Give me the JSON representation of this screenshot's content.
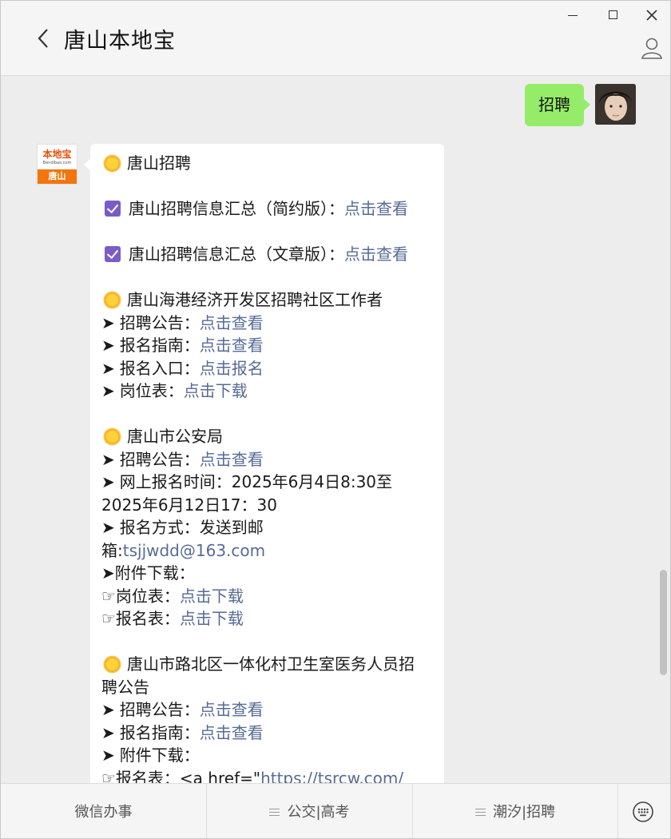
{
  "window": {
    "title": "唐山本地宝",
    "controls": {
      "minimize": "minimize",
      "maximize": "maximize",
      "close": "close"
    }
  },
  "outgoing_message": {
    "text": "招聘"
  },
  "bot": {
    "avatar": {
      "logo_cn": "本地宝",
      "logo_en": "Bendibao.com",
      "city": "唐山"
    },
    "lines": [
      {
        "type": "sun",
        "text": "唐山招聘"
      },
      {
        "type": "blank"
      },
      {
        "type": "check",
        "text": "唐山招聘信息汇总（简约版）：",
        "link": "点击查看"
      },
      {
        "type": "blank"
      },
      {
        "type": "check",
        "text": "唐山招聘信息汇总（文章版）：",
        "link": "点击查看"
      },
      {
        "type": "blank"
      },
      {
        "type": "sun",
        "text": "唐山海港经济开发区招聘社区工作者"
      },
      {
        "type": "arrow",
        "text": "招聘公告：",
        "link": "点击查看"
      },
      {
        "type": "arrow",
        "text": "报名指南：",
        "link": "点击查看"
      },
      {
        "type": "arrow",
        "text": "报名入口：",
        "link": "点击报名"
      },
      {
        "type": "arrow",
        "text": "岗位表：",
        "link": "点击下载"
      },
      {
        "type": "blank"
      },
      {
        "type": "sun",
        "text": "唐山市公安局"
      },
      {
        "type": "arrow",
        "text": "招聘公告：",
        "link": "点击查看"
      },
      {
        "type": "arrow",
        "text": "网上报名时间：2025年6月4日8:30至"
      },
      {
        "type": "plain",
        "text": "2025年6月12日17：30"
      },
      {
        "type": "arrow",
        "text": "报名方式：发送到邮"
      },
      {
        "type": "plain",
        "text": "箱:",
        "link": "tsjjwdd@163.com"
      },
      {
        "type": "plain",
        "text": "➤附件下载："
      },
      {
        "type": "plain",
        "text": "☞岗位表：",
        "link": "点击下载"
      },
      {
        "type": "plain",
        "text": "☞报名表：",
        "link": "点击下载"
      },
      {
        "type": "blank"
      },
      {
        "type": "sun",
        "text": "唐山市路北区一体化村卫生室医务人员招"
      },
      {
        "type": "plain",
        "text": "聘公告"
      },
      {
        "type": "arrow",
        "text": "招聘公告：",
        "link": "点击查看"
      },
      {
        "type": "arrow",
        "text": "报名指南：",
        "link": "点击查看"
      },
      {
        "type": "arrow",
        "text": "附件下载："
      },
      {
        "type": "plain",
        "text": "☞报名表：<a href=\"",
        "link": "https://tsrcw.com/"
      }
    ]
  },
  "bottom_menu": [
    {
      "label": "微信办事",
      "has_menu_icon": false
    },
    {
      "label": "公交|高考",
      "has_menu_icon": true
    },
    {
      "label": "潮汐|招聘",
      "has_menu_icon": true
    }
  ],
  "icons": {
    "back": "chevron-left-icon",
    "profile": "person-icon",
    "keyboard": "keyboard-icon",
    "sun": "sun-emoji-icon",
    "check": "checkbox-icon",
    "arrow": "arrow-right-icon"
  },
  "colors": {
    "outgoing_bubble": "#95ec69",
    "link": "#576b95",
    "brand_orange": "#f2750d",
    "check_purple": "#7a5cc7"
  }
}
